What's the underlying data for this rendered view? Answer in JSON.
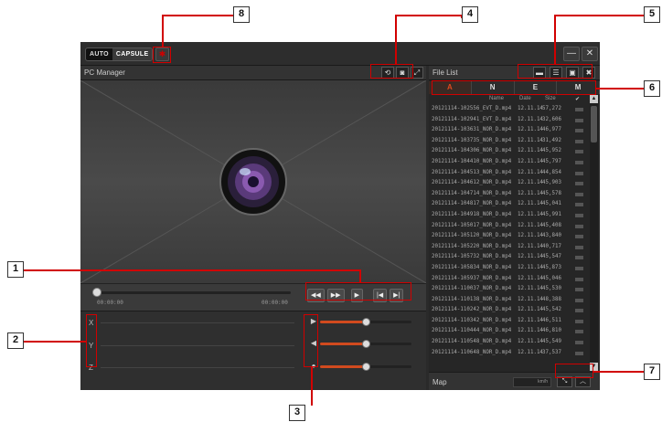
{
  "topbar": {
    "mode_auto": "AUTO",
    "mode_capsule": "CAPSULE",
    "minimize": "—",
    "close": "✕"
  },
  "left_panel": {
    "title": "PC Manager",
    "time_start": "00:00:00",
    "time_end": "00:00:00",
    "axes": [
      "X",
      "Y",
      "Z"
    ],
    "sliders": [
      {
        "icon": "speed-icon",
        "level": 0.5
      },
      {
        "icon": "volume-icon",
        "level": 0.5
      },
      {
        "icon": "brightness-icon",
        "level": 0.5
      }
    ]
  },
  "right_panel": {
    "title": "File List",
    "filter_tabs": [
      "A",
      "N",
      "E",
      "M"
    ],
    "active_tab": "A",
    "columns": {
      "name": "Name",
      "date": "Date",
      "size": "Size"
    },
    "files": [
      {
        "name": "20121114-102556_EVT_D.mp4",
        "date": "12.11.14",
        "size": "57,272"
      },
      {
        "name": "20121114-102941_EVT_D.mp4",
        "date": "12.11.14",
        "size": "32,606"
      },
      {
        "name": "20121114-103631_NOR_D.mp4",
        "date": "12.11.14",
        "size": "46,977"
      },
      {
        "name": "20121114-103735_NOR_D.mp4",
        "date": "12.11.14",
        "size": "31,492"
      },
      {
        "name": "20121114-104306_NOR_D.mp4",
        "date": "12.11.14",
        "size": "45,952"
      },
      {
        "name": "20121114-104410_NOR_D.mp4",
        "date": "12.11.14",
        "size": "45,797"
      },
      {
        "name": "20121114-104513_NOR_D.mp4",
        "date": "12.11.14",
        "size": "44,854"
      },
      {
        "name": "20121114-104612_NOR_D.mp4",
        "date": "12.11.14",
        "size": "45,903"
      },
      {
        "name": "20121114-104714_NOR_D.mp4",
        "date": "12.11.14",
        "size": "45,578"
      },
      {
        "name": "20121114-104817_NOR_D.mp4",
        "date": "12.11.14",
        "size": "45,041"
      },
      {
        "name": "20121114-104918_NOR_D.mp4",
        "date": "12.11.14",
        "size": "45,991"
      },
      {
        "name": "20121114-105017_NOR_D.mp4",
        "date": "12.11.14",
        "size": "45,408"
      },
      {
        "name": "20121114-105120_NOR_D.mp4",
        "date": "12.11.14",
        "size": "43,840"
      },
      {
        "name": "20121114-105220_NOR_D.mp4",
        "date": "12.11.14",
        "size": "40,717"
      },
      {
        "name": "20121114-105732_NOR_D.mp4",
        "date": "12.11.14",
        "size": "45,547"
      },
      {
        "name": "20121114-105834_NOR_D.mp4",
        "date": "12.11.14",
        "size": "45,873"
      },
      {
        "name": "20121114-105937_NOR_D.mp4",
        "date": "12.11.14",
        "size": "45,046"
      },
      {
        "name": "20121114-110037_NOR_D.mp4",
        "date": "12.11.14",
        "size": "45,530"
      },
      {
        "name": "20121114-110138_NOR_D.mp4",
        "date": "12.11.14",
        "size": "48,388"
      },
      {
        "name": "20121114-110242_NOR_D.mp4",
        "date": "12.11.14",
        "size": "45,542"
      },
      {
        "name": "20121114-110342_NOR_D.mp4",
        "date": "12.11.14",
        "size": "46,511"
      },
      {
        "name": "20121114-110444_NOR_D.mp4",
        "date": "12.11.14",
        "size": "46,810"
      },
      {
        "name": "20121114-110548_NOR_D.mp4",
        "date": "12.11.14",
        "size": "45,549"
      },
      {
        "name": "20121114-110648_NOR_D.mp4",
        "date": "12.11.14",
        "size": "37,537"
      }
    ],
    "map_title": "Map",
    "speed_unit": "km/h"
  },
  "callouts": [
    "1",
    "2",
    "3",
    "4",
    "5",
    "6",
    "7",
    "8"
  ],
  "colors": {
    "accent": "#d14a1e",
    "callout": "#d10000"
  }
}
